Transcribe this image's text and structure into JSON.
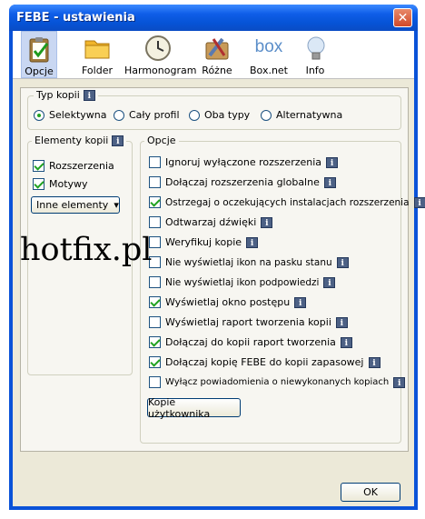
{
  "window": {
    "title": "FEBE - ustawienia",
    "close_symbol": "✕"
  },
  "toolbar": {
    "items": [
      {
        "label": "Opcje",
        "icon": "clipboard-check-icon",
        "selected": true
      },
      {
        "label": "Folder",
        "icon": "folder-icon",
        "selected": false
      },
      {
        "label": "Harmonogram",
        "icon": "clock-icon",
        "selected": false
      },
      {
        "label": "Różne",
        "icon": "tools-icon",
        "selected": false
      },
      {
        "label": "Box.net",
        "icon": "box-logo-icon",
        "selected": false
      },
      {
        "label": "Info",
        "icon": "lightbulb-icon",
        "selected": false
      }
    ],
    "box_logo_text": "box"
  },
  "typ_kopii": {
    "legend": "Typ kopii",
    "options": [
      {
        "label": "Selektywna",
        "selected": true
      },
      {
        "label": "Cały profil",
        "selected": false
      },
      {
        "label": "Oba typy",
        "selected": false
      },
      {
        "label": "Alternatywna",
        "selected": false
      }
    ]
  },
  "elementy": {
    "legend": "Elementy kopii",
    "items": [
      {
        "label": "Rozszerzenia",
        "checked": true
      },
      {
        "label": "Motywy",
        "checked": true
      }
    ],
    "dropdown_label": "Inne elementy",
    "dropdown_arrow": "▾"
  },
  "opcje": {
    "legend": "Opcje",
    "items": [
      {
        "label": "Ignoruj wyłączone rozszerzenia",
        "checked": false
      },
      {
        "label": "Dołączaj rozszerzenia globalne",
        "checked": false
      },
      {
        "label": "Ostrzegaj o oczekujących instalacjach rozszerzenia",
        "checked": true
      },
      {
        "label": "Odtwarzaj dźwięki",
        "checked": false
      },
      {
        "label": "Weryfikuj kopie",
        "checked": false
      },
      {
        "label": "Nie wyświetlaj ikon na pasku stanu",
        "checked": false
      },
      {
        "label": "Nie wyświetlaj ikon podpowiedzi",
        "checked": false
      },
      {
        "label": "Wyświetlaj okno postępu",
        "checked": true
      },
      {
        "label": "Wyświetlaj raport tworzenia kopii",
        "checked": false
      },
      {
        "label": "Dołączaj do kopii raport tworzenia",
        "checked": true
      },
      {
        "label": "Dołączaj kopię FEBE do kopii zapasowej",
        "checked": true
      },
      {
        "label": "Wyłącz powiadomienia o niewykonanych kopiach",
        "checked": false
      }
    ],
    "user_copies_button": "Kopie użytkownika"
  },
  "info_symbol": "i",
  "ok_button": "OK",
  "watermark": "hotfix.pl",
  "colors": {
    "titlebar": "#0a52d8",
    "dialog_bg": "#ece9d8",
    "check": "#21a121"
  }
}
